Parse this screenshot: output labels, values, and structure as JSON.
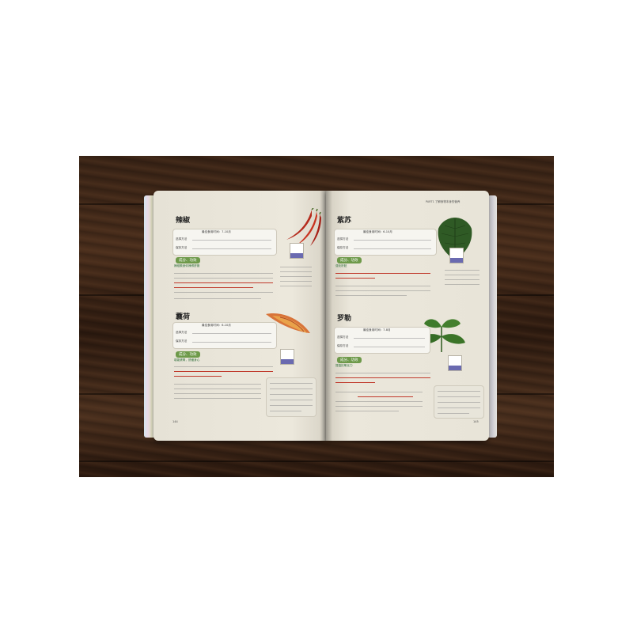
{
  "left_page": {
    "title_1": "辣椒",
    "box_1_line_1": "最佳食用时间：7-10月",
    "box_1_line_2": "选择方法",
    "box_1_line_3": "保存方法",
    "tag_1": "成分、功效",
    "sub_1": "辣椒素使你辣得舒服",
    "title_2": "蘘荷",
    "box_2_line_1": "最佳食用时间：6-10月",
    "box_2_line_2": "选择方法",
    "box_2_line_3": "保存方法",
    "tag_2": "成分、功效",
    "sub_2": "增能健胃，舒缓身心",
    "page_number": "144"
  },
  "right_page": {
    "header": "PART1 了解食物本身的营养",
    "title_1": "紫苏",
    "box_1_line_1": "最佳食用时间：6-10月",
    "box_1_line_2": "选择方法",
    "box_1_line_3": "保存方法",
    "tag_1": "成分、功效",
    "sub_1": "强化肝脏",
    "title_2": "罗勒",
    "box_2_line_1": "最佳食用时间：7-8月",
    "box_2_line_2": "选择方法",
    "box_2_line_3": "保存方法",
    "tag_2": "成分、功效",
    "sub_2": "提高抗氧化力",
    "page_number": "145"
  }
}
